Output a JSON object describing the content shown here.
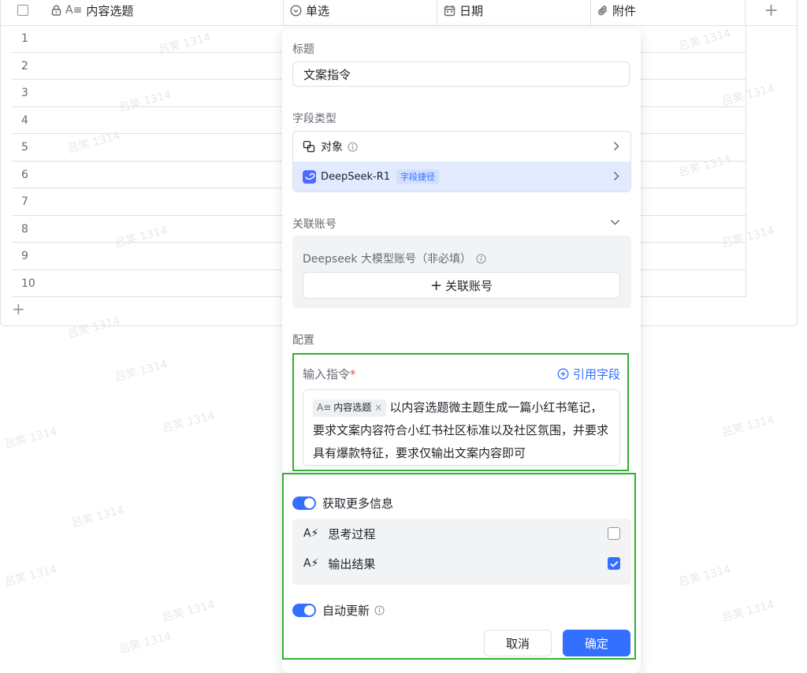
{
  "table": {
    "columns": [
      {
        "label": "内容选题",
        "icon": "text-icon"
      },
      {
        "label": "单选",
        "icon": "single-select-icon"
      },
      {
        "label": "日期",
        "icon": "calendar-icon"
      },
      {
        "label": "附件",
        "icon": "paperclip-icon"
      }
    ],
    "rows": [
      "1",
      "2",
      "3",
      "4",
      "5",
      "6",
      "7",
      "8",
      "9",
      "10"
    ]
  },
  "watermark": "吕笑 1314",
  "panel": {
    "title_label": "标题",
    "title_value": "文案指令",
    "field_type_label": "字段类型",
    "field_type_object": "对象",
    "field_type_selected": "DeepSeek-R1",
    "field_type_tag": "字段捷径",
    "linked_account_label": "关联账号",
    "account_hint": "Deepseek 大模型账号（非必填）",
    "link_account_button": "关联账号",
    "config_label": "配置",
    "input_cmd_label": "输入指令",
    "required_mark": "*",
    "ref_field_link": "引用字段",
    "chip_label": "内容选题",
    "cmd_text": "以内容选题微主题生成一篇小红书笔记，要求文案内容符合小红书社区标准以及社区氛围，并要求具有爆款特征，要求仅输出文案内容即可",
    "more_info_label": "获取更多信息",
    "options": [
      {
        "label": "思考过程",
        "checked": false
      },
      {
        "label": "输出结果",
        "checked": true
      }
    ],
    "auto_update_label": "自动更新",
    "cancel": "取消",
    "confirm": "确定"
  },
  "colors": {
    "accent": "#3370ff",
    "highlight_border": "#2fb12f"
  }
}
